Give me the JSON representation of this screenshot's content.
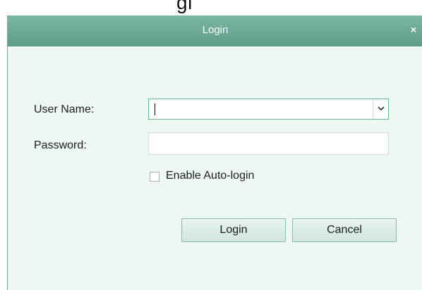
{
  "background": {
    "partial_title": "gi"
  },
  "dialog": {
    "title": "Login",
    "close_glyph": "×"
  },
  "form": {
    "username_label": "User Name:",
    "username_value": "",
    "password_label": "Password:",
    "password_value": "",
    "auto_login_label": "Enable Auto-login",
    "auto_login_checked": false
  },
  "buttons": {
    "login_label": "Login",
    "cancel_label": "Cancel"
  },
  "icons": {
    "close": "close-icon",
    "dropdown": "chevron-down-icon"
  },
  "colors": {
    "titlebar": "#6aa994",
    "dialog_bg": "#eef8f3",
    "focus_border": "#63c08e",
    "button_border": "#8db7a6"
  }
}
